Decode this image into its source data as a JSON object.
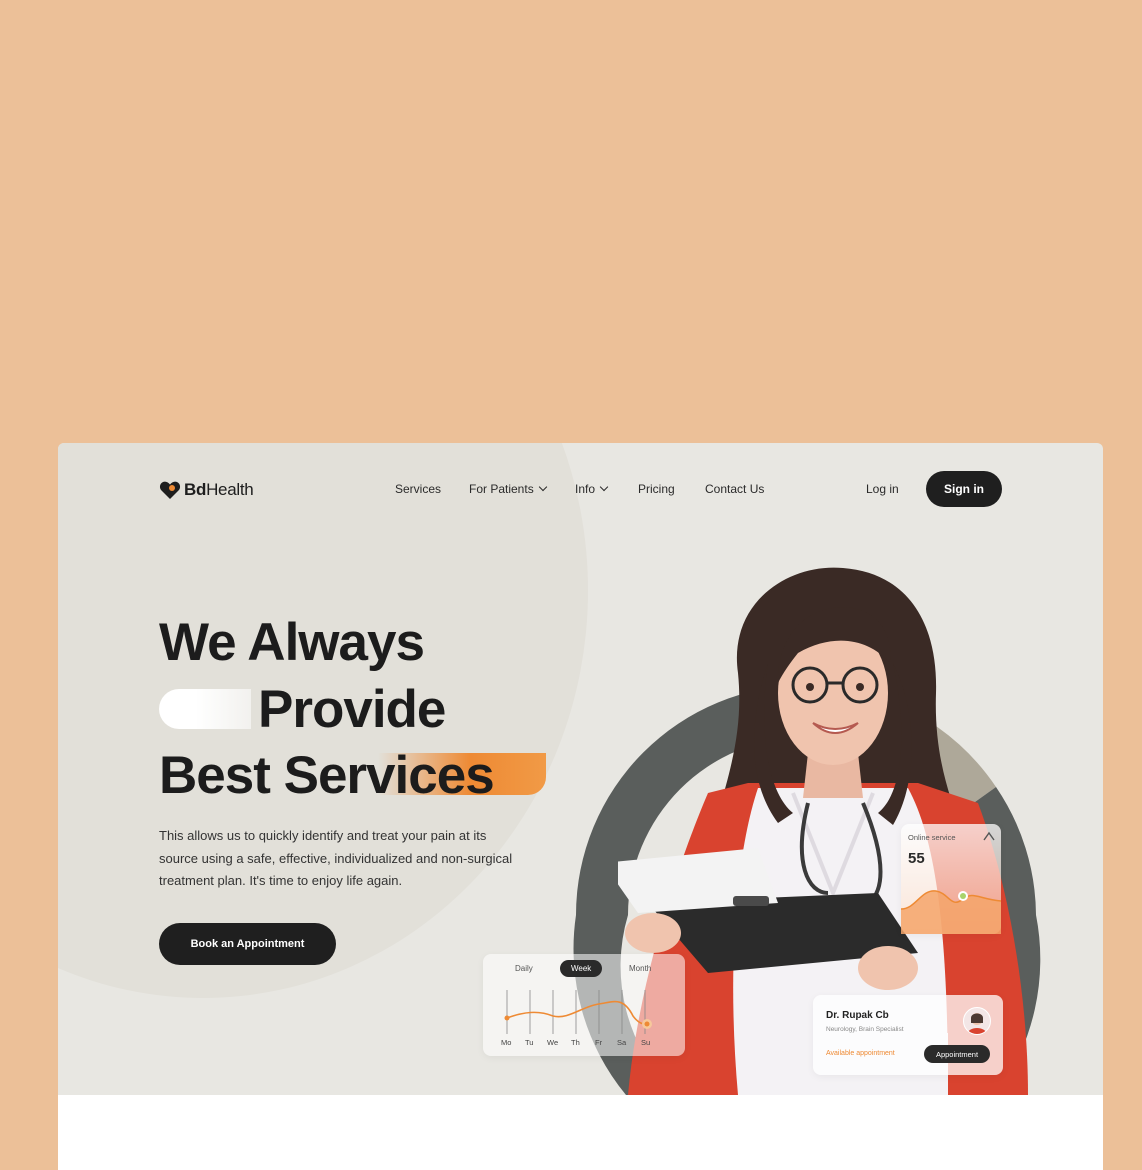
{
  "brand": {
    "name_bold": "Bd",
    "name_rest": "Health",
    "accent": "#EE8A34",
    "page_background": "#ECC098",
    "card_background": "#E8E7E2"
  },
  "nav": {
    "items": [
      {
        "label": "Services",
        "dropdown": false
      },
      {
        "label": "For Patients",
        "dropdown": true
      },
      {
        "label": "Info",
        "dropdown": true
      },
      {
        "label": "Pricing",
        "dropdown": false
      },
      {
        "label": "Contact Us",
        "dropdown": false
      }
    ],
    "login": "Log in",
    "signin": "Sign in"
  },
  "hero": {
    "line1": "We Always",
    "line2": "Provide",
    "line3": "Best Services",
    "description": "This allows us to quickly identify and treat your pain at its source using a safe, effective, individualized and non-surgical treatment plan. It's time to enjoy life again.",
    "cta": "Book an Appointment"
  },
  "activity_card": {
    "tabs": [
      "Daily",
      "Week",
      "Month"
    ],
    "active_tab": "Week",
    "days": [
      "Mo",
      "Tu",
      "We",
      "Th",
      "Fr",
      "Sa",
      "Su"
    ]
  },
  "rate_card": {
    "label": "Online service",
    "value": "55"
  },
  "doctor_card": {
    "name": "Dr. Rupak Cb",
    "subtitle": "Neurology, Brain Specialist",
    "link": "Available appointment",
    "button": "Appointment"
  }
}
